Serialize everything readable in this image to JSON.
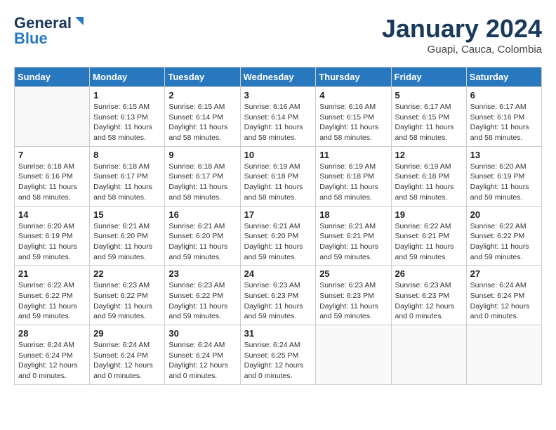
{
  "header": {
    "logo_line1": "General",
    "logo_line2": "Blue",
    "month_year": "January 2024",
    "location": "Guapi, Cauca, Colombia"
  },
  "days_of_week": [
    "Sunday",
    "Monday",
    "Tuesday",
    "Wednesday",
    "Thursday",
    "Friday",
    "Saturday"
  ],
  "weeks": [
    [
      {
        "num": "",
        "detail": ""
      },
      {
        "num": "1",
        "detail": "Sunrise: 6:15 AM\nSunset: 6:13 PM\nDaylight: 11 hours\nand 58 minutes."
      },
      {
        "num": "2",
        "detail": "Sunrise: 6:15 AM\nSunset: 6:14 PM\nDaylight: 11 hours\nand 58 minutes."
      },
      {
        "num": "3",
        "detail": "Sunrise: 6:16 AM\nSunset: 6:14 PM\nDaylight: 11 hours\nand 58 minutes."
      },
      {
        "num": "4",
        "detail": "Sunrise: 6:16 AM\nSunset: 6:15 PM\nDaylight: 11 hours\nand 58 minutes."
      },
      {
        "num": "5",
        "detail": "Sunrise: 6:17 AM\nSunset: 6:15 PM\nDaylight: 11 hours\nand 58 minutes."
      },
      {
        "num": "6",
        "detail": "Sunrise: 6:17 AM\nSunset: 6:16 PM\nDaylight: 11 hours\nand 58 minutes."
      }
    ],
    [
      {
        "num": "7",
        "detail": "Sunrise: 6:18 AM\nSunset: 6:16 PM\nDaylight: 11 hours\nand 58 minutes."
      },
      {
        "num": "8",
        "detail": "Sunrise: 6:18 AM\nSunset: 6:17 PM\nDaylight: 11 hours\nand 58 minutes."
      },
      {
        "num": "9",
        "detail": "Sunrise: 6:18 AM\nSunset: 6:17 PM\nDaylight: 11 hours\nand 58 minutes."
      },
      {
        "num": "10",
        "detail": "Sunrise: 6:19 AM\nSunset: 6:18 PM\nDaylight: 11 hours\nand 58 minutes."
      },
      {
        "num": "11",
        "detail": "Sunrise: 6:19 AM\nSunset: 6:18 PM\nDaylight: 11 hours\nand 58 minutes."
      },
      {
        "num": "12",
        "detail": "Sunrise: 6:19 AM\nSunset: 6:18 PM\nDaylight: 11 hours\nand 58 minutes."
      },
      {
        "num": "13",
        "detail": "Sunrise: 6:20 AM\nSunset: 6:19 PM\nDaylight: 11 hours\nand 59 minutes."
      }
    ],
    [
      {
        "num": "14",
        "detail": "Sunrise: 6:20 AM\nSunset: 6:19 PM\nDaylight: 11 hours\nand 59 minutes."
      },
      {
        "num": "15",
        "detail": "Sunrise: 6:21 AM\nSunset: 6:20 PM\nDaylight: 11 hours\nand 59 minutes."
      },
      {
        "num": "16",
        "detail": "Sunrise: 6:21 AM\nSunset: 6:20 PM\nDaylight: 11 hours\nand 59 minutes."
      },
      {
        "num": "17",
        "detail": "Sunrise: 6:21 AM\nSunset: 6:20 PM\nDaylight: 11 hours\nand 59 minutes."
      },
      {
        "num": "18",
        "detail": "Sunrise: 6:21 AM\nSunset: 6:21 PM\nDaylight: 11 hours\nand 59 minutes."
      },
      {
        "num": "19",
        "detail": "Sunrise: 6:22 AM\nSunset: 6:21 PM\nDaylight: 11 hours\nand 59 minutes."
      },
      {
        "num": "20",
        "detail": "Sunrise: 6:22 AM\nSunset: 6:22 PM\nDaylight: 11 hours\nand 59 minutes."
      }
    ],
    [
      {
        "num": "21",
        "detail": "Sunrise: 6:22 AM\nSunset: 6:22 PM\nDaylight: 11 hours\nand 59 minutes."
      },
      {
        "num": "22",
        "detail": "Sunrise: 6:23 AM\nSunset: 6:22 PM\nDaylight: 11 hours\nand 59 minutes."
      },
      {
        "num": "23",
        "detail": "Sunrise: 6:23 AM\nSunset: 6:22 PM\nDaylight: 11 hours\nand 59 minutes."
      },
      {
        "num": "24",
        "detail": "Sunrise: 6:23 AM\nSunset: 6:23 PM\nDaylight: 11 hours\nand 59 minutes."
      },
      {
        "num": "25",
        "detail": "Sunrise: 6:23 AM\nSunset: 6:23 PM\nDaylight: 11 hours\nand 59 minutes."
      },
      {
        "num": "26",
        "detail": "Sunrise: 6:23 AM\nSunset: 6:23 PM\nDaylight: 12 hours\nand 0 minutes."
      },
      {
        "num": "27",
        "detail": "Sunrise: 6:24 AM\nSunset: 6:24 PM\nDaylight: 12 hours\nand 0 minutes."
      }
    ],
    [
      {
        "num": "28",
        "detail": "Sunrise: 6:24 AM\nSunset: 6:24 PM\nDaylight: 12 hours\nand 0 minutes."
      },
      {
        "num": "29",
        "detail": "Sunrise: 6:24 AM\nSunset: 6:24 PM\nDaylight: 12 hours\nand 0 minutes."
      },
      {
        "num": "30",
        "detail": "Sunrise: 6:24 AM\nSunset: 6:24 PM\nDaylight: 12 hours\nand 0 minutes."
      },
      {
        "num": "31",
        "detail": "Sunrise: 6:24 AM\nSunset: 6:25 PM\nDaylight: 12 hours\nand 0 minutes."
      },
      {
        "num": "",
        "detail": ""
      },
      {
        "num": "",
        "detail": ""
      },
      {
        "num": "",
        "detail": ""
      }
    ]
  ]
}
